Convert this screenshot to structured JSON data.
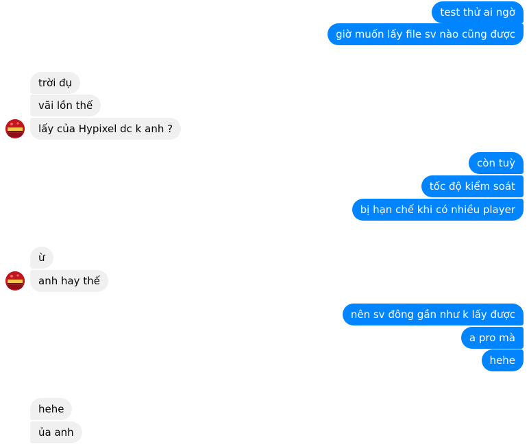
{
  "colors": {
    "outgoing_bubble": "#0084ff",
    "outgoing_text": "#ffffff",
    "incoming_bubble": "#f0f0f0",
    "incoming_text": "#050505",
    "avatar": "#c3161c"
  },
  "messages": {
    "m1": "test thử ai ngờ",
    "m2": "giờ muốn lấy file sv nào cũng được",
    "m3": "trời đụ",
    "m4": "vãi lồn thế",
    "m5": "lấy của Hypixel dc k anh ?",
    "m6": "còn tuỳ",
    "m7": "tốc độ kiểm soát",
    "m8": "bị hạn chế khi có nhiều player",
    "m9": "ừ",
    "m10": "anh hay thế",
    "m11": "nên sv đông gần như k lấy được",
    "m12": "a pro mà",
    "m13": "hehe",
    "m14": "hehe",
    "m15": "ủa anh"
  },
  "avatar": {
    "icon": "red-logo-avatar-icon"
  }
}
